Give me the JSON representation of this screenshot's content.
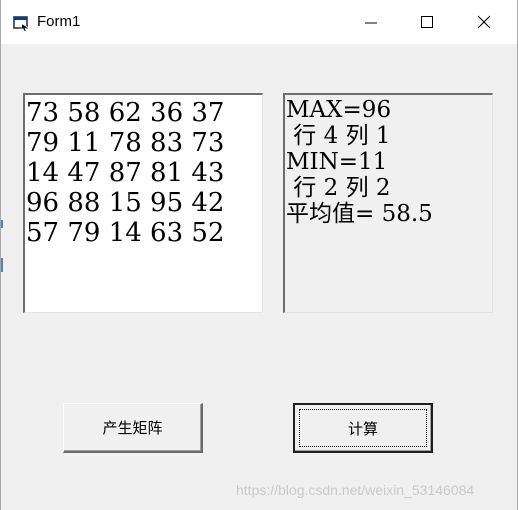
{
  "window": {
    "title": "Form1",
    "icons": {
      "app": "form-icon",
      "minimize": "minimize-icon",
      "maximize": "maximize-icon",
      "close": "close-icon"
    }
  },
  "matrix": {
    "rows": [
      "73 58 62 36 37",
      "79 11 78 83 73",
      "14 47 87 81 43",
      "96 88 15 95 42",
      "57 79 14 63 52"
    ]
  },
  "results": {
    "lines": [
      "MAX=96",
      " 行 4 列 1",
      "MIN=11",
      " 行 2 列 2",
      "平均值= 58.5"
    ]
  },
  "buttons": {
    "generate": "产生矩阵",
    "calculate": "计算"
  },
  "watermark": "https://blog.csdn.net/weixin_53146084"
}
